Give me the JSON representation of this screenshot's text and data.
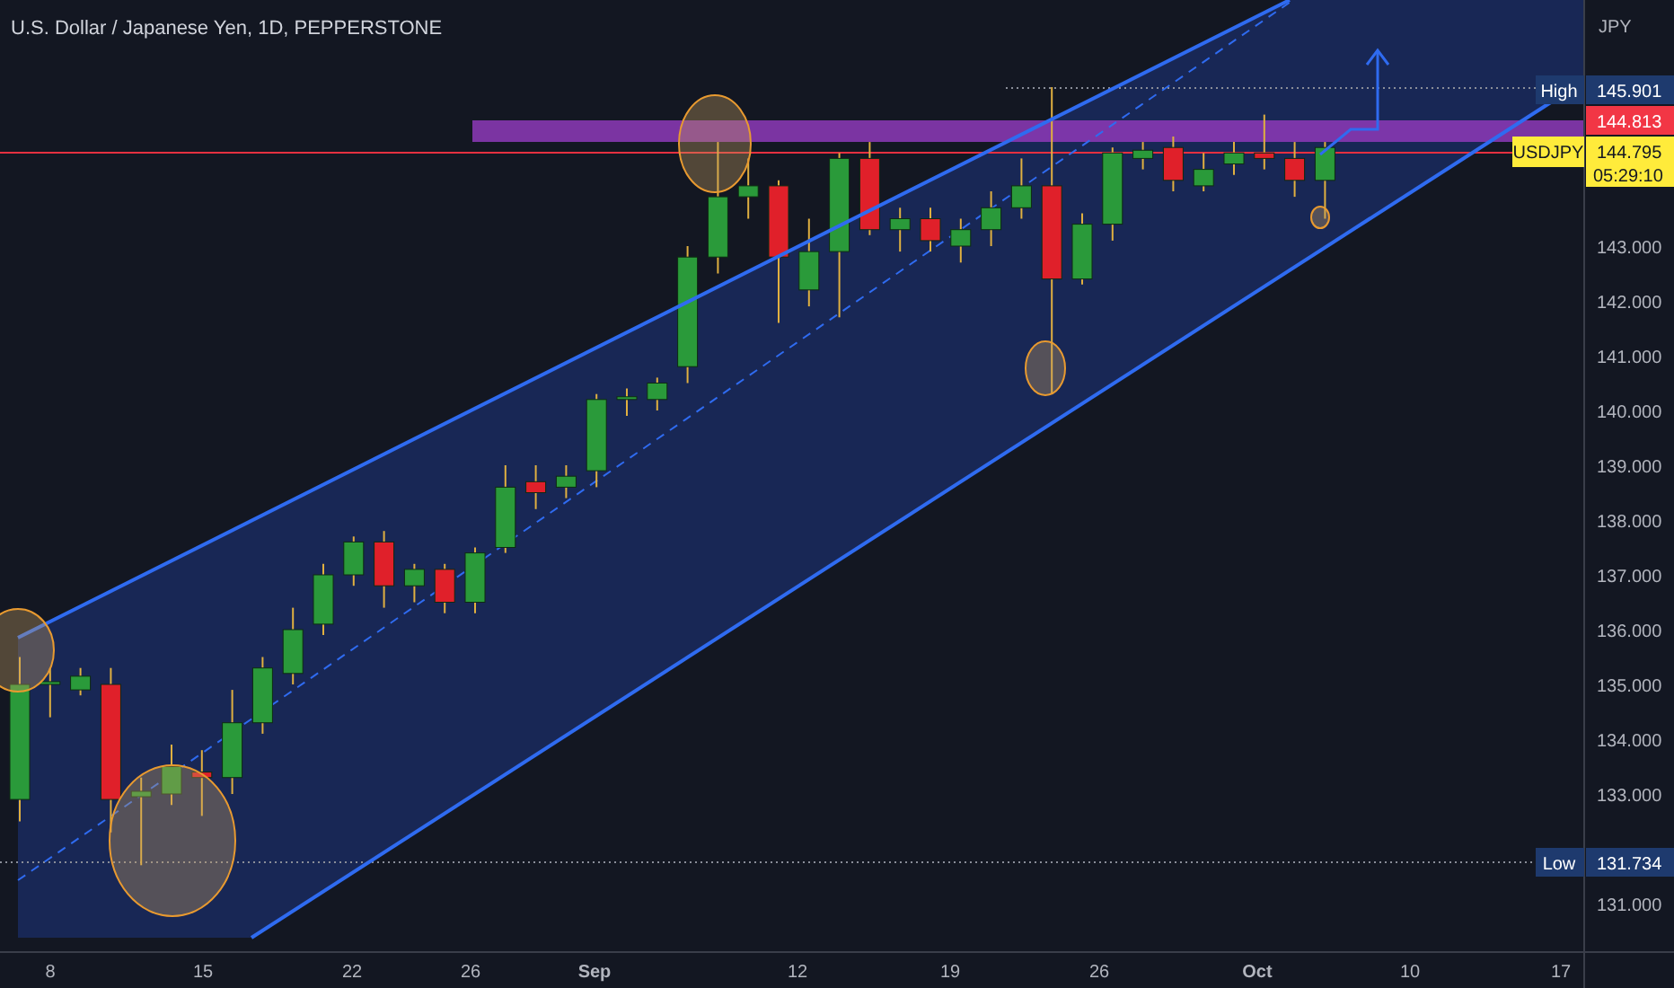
{
  "header": {
    "title": "U.S. Dollar / Japanese Yen, 1D, PEPPERSTONE"
  },
  "price_axis": {
    "currency": "JPY",
    "ticks": [
      "143.000",
      "142.000",
      "141.000",
      "140.000",
      "139.000",
      "138.000",
      "137.000",
      "136.000",
      "135.000",
      "134.000",
      "133.000",
      "131.000"
    ]
  },
  "markers": [
    {
      "kind": "high",
      "label": "High",
      "value": "145.901"
    },
    {
      "kind": "alert",
      "value": "144.813"
    },
    {
      "kind": "last",
      "label": "USDJPY",
      "value": "144.795",
      "countdown": "05:29:10"
    },
    {
      "kind": "low",
      "label": "Low",
      "value": "131.734"
    }
  ],
  "time_axis": {
    "labels": [
      {
        "text": "8",
        "kind": "day"
      },
      {
        "text": "15",
        "kind": "day"
      },
      {
        "text": "22",
        "kind": "day"
      },
      {
        "text": "26",
        "kind": "day"
      },
      {
        "text": "Sep",
        "kind": "month"
      },
      {
        "text": "12",
        "kind": "day"
      },
      {
        "text": "19",
        "kind": "day"
      },
      {
        "text": "26",
        "kind": "day"
      },
      {
        "text": "Oct",
        "kind": "month"
      },
      {
        "text": "10",
        "kind": "day"
      },
      {
        "text": "17",
        "kind": "day"
      }
    ]
  }
}
